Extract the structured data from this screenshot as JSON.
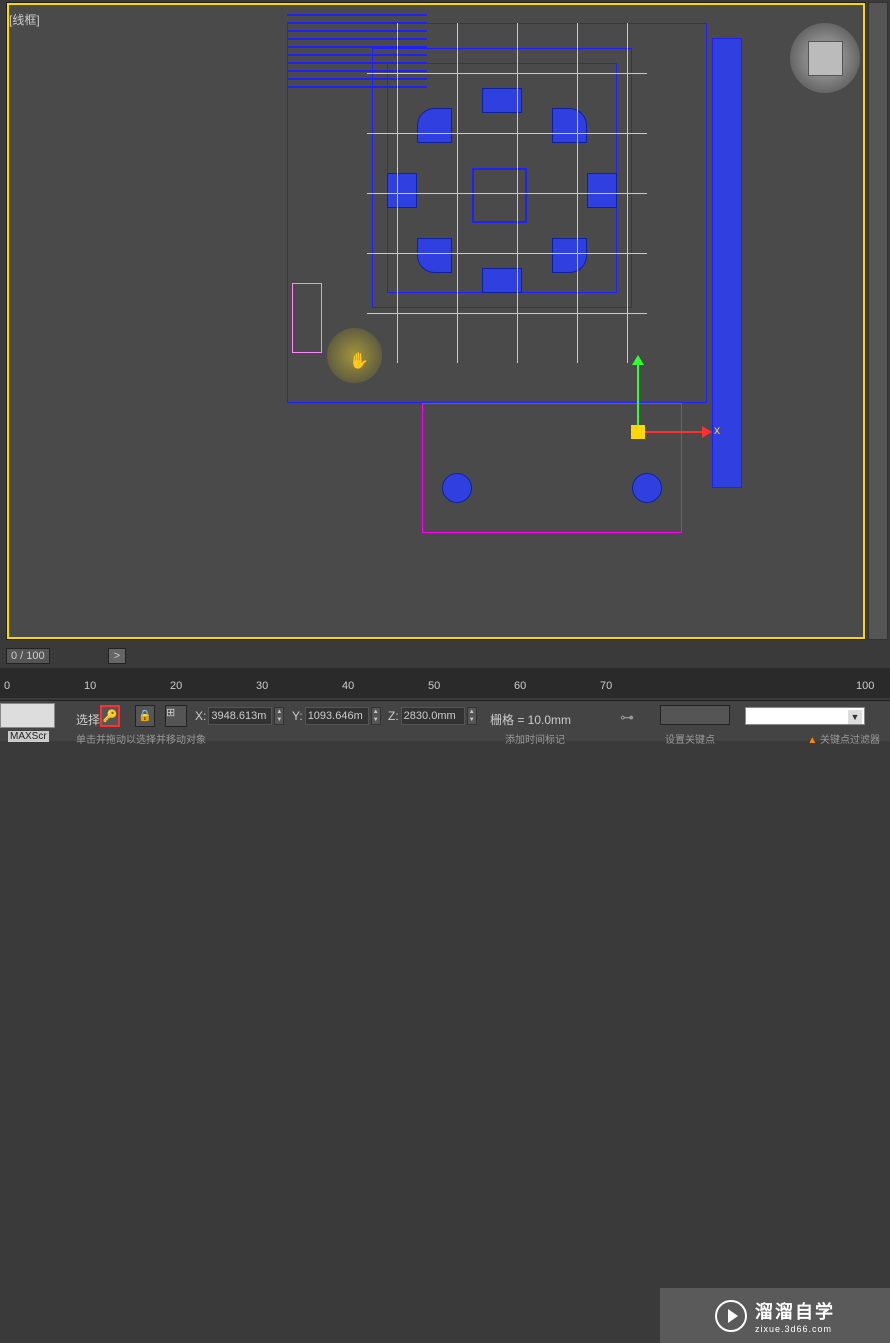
{
  "viewport": {
    "label": "[线框]"
  },
  "gizmo": {
    "x_label": "x"
  },
  "timeline": {
    "frame_counter": "0 / 100",
    "expand_label": ">",
    "ticks": [
      "0",
      "10",
      "20",
      "30",
      "40",
      "50",
      "60",
      "70",
      "100"
    ]
  },
  "watermark": {
    "main": "溜溜自学",
    "sub": "zixue.3d66.com"
  },
  "bottom": {
    "maxscript": "MAXScr",
    "select_label": "选择",
    "coords": {
      "x_label": "X:",
      "x_value": "3948.613m",
      "y_label": "Y:",
      "y_value": "1093.646m",
      "z_label": "Z:",
      "z_value": "2830.0mm"
    },
    "grid_label": "栅格 = 10.0mm",
    "set_key": "设置关键点",
    "key_filter": "关键点过滤器",
    "hint": "单击并拖动以选择并移动对象",
    "time_tag": "添加时间标记"
  }
}
